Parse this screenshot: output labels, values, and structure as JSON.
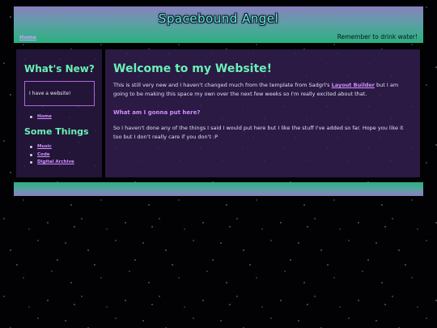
{
  "header": {
    "title": "Spacebound Angel",
    "nav_home": "Home",
    "message": "Remember to drink water!"
  },
  "sidebar": {
    "news_heading": "What's New?",
    "news_text": "I have a website!",
    "links_a": [
      {
        "label": "Home"
      }
    ],
    "things_heading": "Some Things",
    "links_b": [
      {
        "label": "Music"
      },
      {
        "label": "Code"
      },
      {
        "label": "Digital Archive"
      }
    ]
  },
  "main": {
    "title": "Welcome to my Website!",
    "para1_before": "This is still very new and I haven't changed much from the template from Sadgrl's ",
    "para1_link": "Layout Builder",
    "para1_after": " but I am going to be making this space my own over the next few weeks so I'm really excited about that.",
    "subheading": "What am I gonna put here?",
    "para2": "So I haven't done any of the things I said I would put here but I like the stuff I've added so far. Hope you like it too but I don't really care if you don't :P"
  },
  "colors": {
    "accent_green": "#6bf0b4",
    "link_purple": "#d390ff",
    "panel": "#2a1a44"
  }
}
